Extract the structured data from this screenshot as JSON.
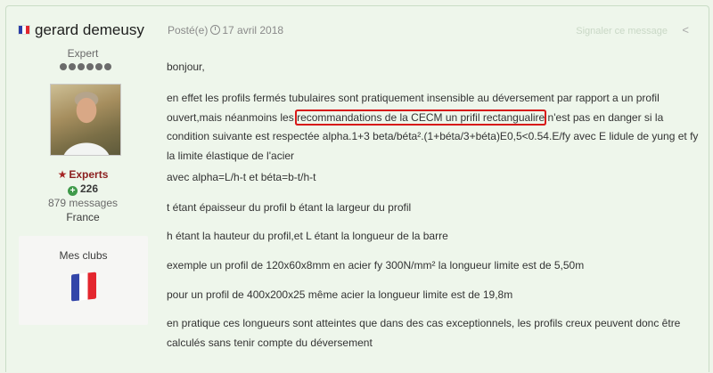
{
  "author": {
    "name": "gerard demeusy",
    "title": "Expert",
    "pips": 6,
    "group": "Experts",
    "reputation": "226",
    "messages": "879 messages",
    "country": "France",
    "clubs_title": "Mes clubs"
  },
  "post": {
    "posted_label": "Posté(e)",
    "date": "17 avril 2018",
    "report_label": "Signaler ce message",
    "line1": "bonjour,",
    "para2_a": "en effet les profils fermés tubulaires sont pratiquement insensible au déversement par rapport a un profil ouvert,mais néanmoins les ",
    "para2_hl": "recommandations de la CECM un prifil rectangualire",
    "para2_b": " n'est pas en danger si la condition suivante est respectée alpha.1+3  beta/béta².(1+béta/3+béta)E0,5<0.54.E/fy avec E lidule de yung et fy la limite élastique de l'acier",
    "line3": "avec alpha=L/h-t et béta=b-t/h-t",
    "line4": "t étant épaisseur du profil b étant la largeur du profil",
    "line5": "h étant la hauteur du profil,et L étant la longueur de la barre",
    "line6": "exemple un profil de 120x60x8mm en acier fy 300N/mm² la longueur limite est de 5,50m",
    "line7": "pour un profil de 400x200x25 même acier la longueur limite est de 19,8m",
    "line8": "en pratique ces longueurs sont atteintes que dans des cas exceptionnels, les profils creux peuvent donc être calculés sans tenir compte du déversement"
  },
  "colors": {
    "background": "#eef6eb",
    "group": "#8b1e1e",
    "highlight_border": "#d71919",
    "reputation_icon": "#3f9a4a"
  },
  "icons": {
    "flag": "france-flag-icon",
    "star": "star-icon",
    "plus": "plus-circle-icon",
    "clock": "clock-icon",
    "share": "share-icon"
  }
}
